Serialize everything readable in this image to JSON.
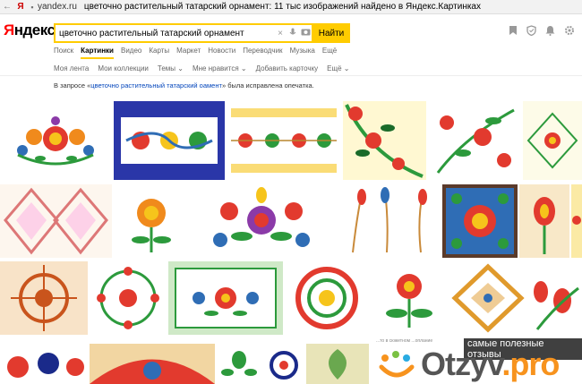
{
  "browser": {
    "back": "←",
    "ya": "Я",
    "lock": "🔒",
    "domain": "yandex.ru",
    "title": "цветочно растительный татарский орнамент: 11 тыс изображений найдено в Яндекс.Картинках"
  },
  "header": {
    "logo_y": "Я",
    "logo_rest": "ндекс",
    "search_value": "цветочно растительный татарский орнамент",
    "clear_icon": "×",
    "find_label": "Найти"
  },
  "tabs": [
    "Поиск",
    "Картинки",
    "Видео",
    "Карты",
    "Маркет",
    "Новости",
    "Переводчик",
    "Музыка",
    "Ещё"
  ],
  "active_tab": 1,
  "subnav": [
    "Моя лента",
    "Мои коллекции",
    "Темы ⌄",
    "Мне нравится ⌄",
    "Добавить карточку",
    "Ещё ⌄"
  ],
  "correction": {
    "prefix": "В запросе «",
    "link": "цветочно растительный татарский оамент",
    "suffix": "» была исправлена опечатка."
  },
  "watermark": {
    "tag": "самые полезные отзывы",
    "brand_a": "Otzyv",
    "brand_b": ".pro",
    "small_caption": "...то в сюжетном ...оплание"
  },
  "colors": {
    "accent_yellow": "#ffcc00",
    "link_blue": "#0044bb",
    "logo_red": "#ff0000",
    "otzyv_orange": "#f7931e"
  }
}
